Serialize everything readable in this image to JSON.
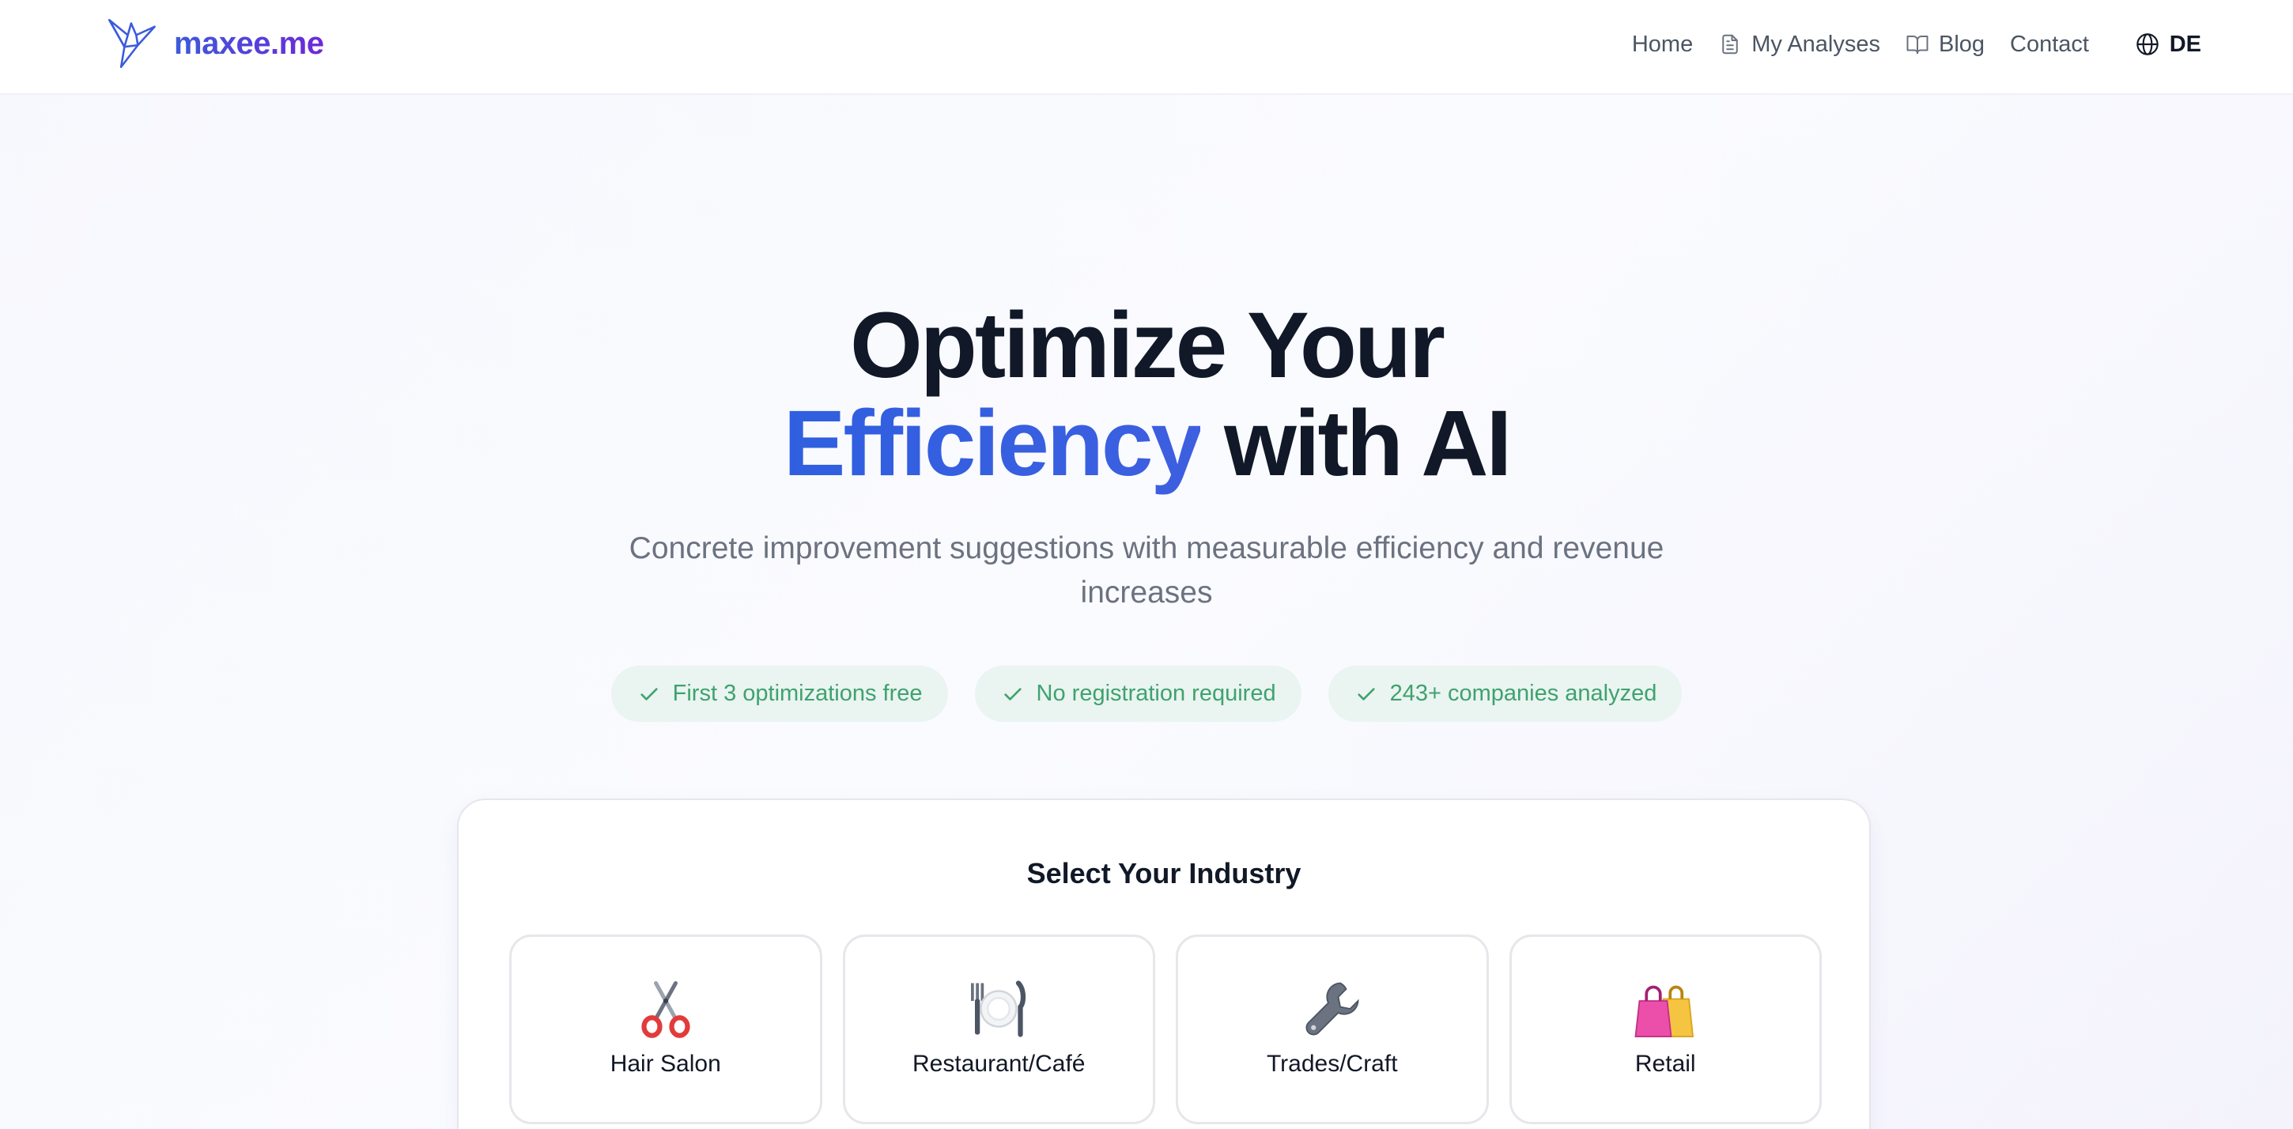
{
  "header": {
    "logo_text": "maxee.me",
    "nav": [
      {
        "label": "Home",
        "icon": null
      },
      {
        "label": "My Analyses",
        "icon": "document-icon"
      },
      {
        "label": "Blog",
        "icon": "book-icon"
      },
      {
        "label": "Contact",
        "icon": null
      }
    ],
    "language": {
      "label": "DE",
      "icon": "globe-icon"
    }
  },
  "hero": {
    "title_line1": "Optimize Your",
    "title_accent": "Efficiency",
    "title_rest": " with AI",
    "subtitle": "Concrete improvement suggestions with measurable efficiency and revenue increases",
    "badges": [
      {
        "label": "First 3 optimizations free",
        "icon": "check-icon"
      },
      {
        "label": "No registration required",
        "icon": "check-icon"
      },
      {
        "label": "243+ companies analyzed",
        "icon": "check-icon"
      }
    ]
  },
  "industry_card": {
    "title": "Select Your Industry",
    "items": [
      {
        "label": "Hair Salon",
        "icon": "scissors-icon"
      },
      {
        "label": "Restaurant/Café",
        "icon": "plate-cutlery-icon"
      },
      {
        "label": "Trades/Craft",
        "icon": "wrench-icon"
      },
      {
        "label": "Retail",
        "icon": "shopping-bags-icon"
      }
    ]
  },
  "colors": {
    "brand": "#4f46e5",
    "accent_blue": "#2f5fe0",
    "badge_bg": "#eaf4f0",
    "badge_text": "#3fa26f",
    "text_dark": "#111827",
    "text_muted": "#6b7280"
  }
}
